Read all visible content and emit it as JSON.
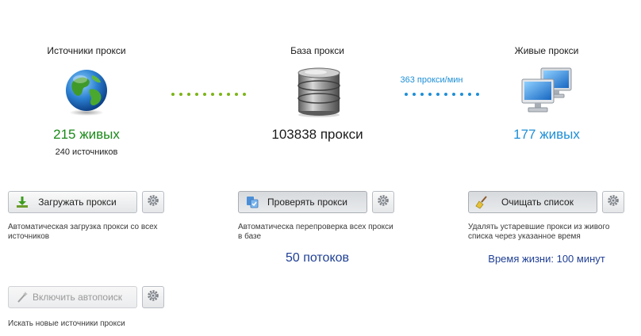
{
  "sources": {
    "title": "Источники прокси",
    "live": "215 живых",
    "sources_count": "240 источников",
    "icon": "globe-icon",
    "button_label": "Загружать прокси",
    "button_icon": "download-arrow-icon",
    "description": "Автоматическая загрузка прокси со всех источников"
  },
  "base": {
    "title": "База прокси",
    "count": "103838 прокси",
    "icon": "database-icon",
    "button_label": "Проверять прокси",
    "button_icon": "check-proxy-icon",
    "description": "Автоматическа перепроверка всех прокси в базе",
    "threads": "50 потоков"
  },
  "live": {
    "title": "Живые прокси",
    "live": "177 живых",
    "icon": "monitors-icon",
    "button_label": "Очищать список",
    "button_icon": "broom-icon",
    "description": "Удалять устаревшие прокси из живого списка через указанное время",
    "lifetime": "Время жизни: 100 минут"
  },
  "rate": "363 прокси/мин",
  "autosearch": {
    "button_label": "Включить автопоиск",
    "button_icon": "magic-wand-icon",
    "description": "Искать новые источники прокси"
  },
  "colors": {
    "green": "#1a8a1a",
    "green_dots": "#7cb518",
    "blue_link": "#1e8fd6",
    "dark_blue": "#1f3f95",
    "live_blue": "#1e8fd6"
  }
}
